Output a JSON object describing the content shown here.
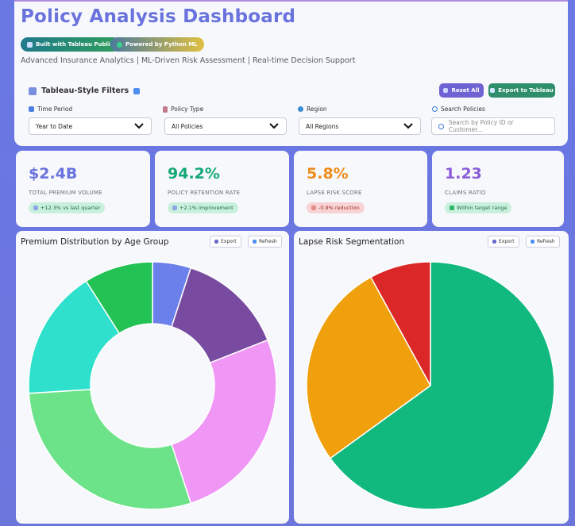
{
  "header": {
    "title": "Policy Analysis Dashboard",
    "badges": {
      "tableau": "Built with Tableau Public",
      "python": "Powered by Python ML"
    },
    "subtitle": "Advanced Insurance Analytics | ML-Driven Risk Assessment | Real-time Decision Support"
  },
  "filters": {
    "title": "Tableau-Style Filters",
    "reset_label": "Reset All",
    "export_label": "Export to Tableau",
    "time_period": {
      "label": "Time Period",
      "value": "Year to Date"
    },
    "policy_type": {
      "label": "Policy Type",
      "value": "All Policies"
    },
    "region": {
      "label": "Region",
      "value": "All Regions"
    },
    "search": {
      "label": "Search Policies",
      "placeholder": "Search by Policy ID or Customer..."
    }
  },
  "kpis": [
    {
      "value": "$2.4B",
      "label": "TOTAL PREMIUM VOLUME",
      "pill": "+12.3% vs last quarter",
      "color": "#6a73dd",
      "pill_type": "green"
    },
    {
      "value": "94.2%",
      "label": "POLICY RETENTION RATE",
      "pill": "+2.1% improvement",
      "color": "#14a874",
      "pill_type": "green"
    },
    {
      "value": "5.8%",
      "label": "LAPSE RISK SCORE",
      "pill": "-0.9% reduction",
      "color": "#ee8c1a",
      "pill_type": "red"
    },
    {
      "value": "1.23",
      "label": "CLAIMS RATIO",
      "pill": "Within target range",
      "color": "#8a5cd6",
      "pill_type": "green"
    }
  ],
  "panels": {
    "left": {
      "title": "Premium Distribution by Age Group",
      "export": "Export",
      "refresh": "Refresh"
    },
    "right": {
      "title": "Lapse Risk Segmentation",
      "export": "Export",
      "refresh": "Refresh"
    }
  },
  "chart_data": [
    {
      "type": "pie",
      "variant": "doughnut",
      "title": "Premium Distribution by Age Group",
      "values": [
        5,
        14,
        26,
        29,
        17,
        9
      ],
      "colors": [
        "#6b80ea",
        "#784ba0",
        "#f097f5",
        "#6ce389",
        "#2fe0cc",
        "#22c254"
      ]
    },
    {
      "type": "pie",
      "title": "Lapse Risk Segmentation",
      "values": [
        65,
        27,
        8
      ],
      "colors": [
        "#12b97f",
        "#f09f0d",
        "#db2727"
      ]
    }
  ]
}
